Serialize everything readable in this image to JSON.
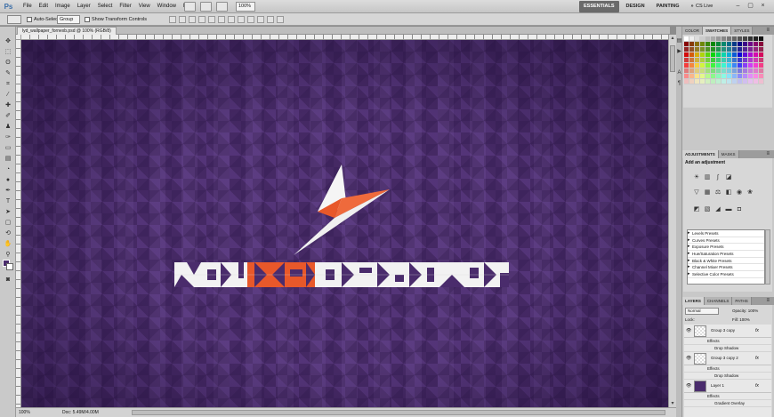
{
  "menubar": {
    "logo": "Ps",
    "items": [
      "File",
      "Edit",
      "Image",
      "Layer",
      "Select",
      "Filter",
      "View",
      "Window",
      "Help"
    ],
    "zoom": "100%",
    "workspaces": [
      "ESSENTIALS",
      "DESIGN",
      "PAINTING",
      "»"
    ],
    "cs_live": "CS Live",
    "window_buttons": [
      "–",
      "▢",
      "×"
    ]
  },
  "optionsbar": {
    "auto_select_label": "Auto-Select:",
    "auto_select_value": "Group",
    "show_transform_label": "Show Transform Controls"
  },
  "document": {
    "tab_title": "lyd_wallpaper_fornexb.psd @ 100% (RGB/8)",
    "status_zoom": "100%",
    "status_doc": "Doc: 5.49M/4.00M"
  },
  "artwork": {
    "logo_text": "YOUTHDESIGNER",
    "colors": {
      "background": "#4a2c6c",
      "accent": "#e8582a",
      "white": "#f2f2f2"
    }
  },
  "panels": {
    "top_tabs": [
      "COLOR",
      "SWATCHES",
      "STYLES"
    ],
    "top_active": 1,
    "adjust_tabs": [
      "ADJUSTMENTS",
      "MASKS"
    ],
    "adjust_active": 0,
    "adjust_title": "Add an adjustment",
    "presets": [
      "Levels Presets",
      "Curves Presets",
      "Exposure Presets",
      "Hue/Saturation Presets",
      "Black & White Presets",
      "Channel Mixer Presets",
      "Selective Color Presets"
    ],
    "layer_tabs": [
      "LAYERS",
      "CHANNELS",
      "PATHS"
    ],
    "layer_active": 0,
    "blend_mode": "Normal",
    "opacity_label": "Opacity:",
    "opacity_value": "100%",
    "fill_label": "Fill:",
    "fill_value": "100%",
    "lock_label": "Lock:",
    "layers": [
      {
        "name": "Group 3 copy",
        "effects_label": "Effects",
        "effect": "Drop Shadow"
      },
      {
        "name": "Group 3 copy 2",
        "effects_label": "Effects",
        "effect": "Drop Shadow"
      },
      {
        "name": "Layer 1",
        "effects_label": "Effects",
        "effect": "Gradient Overlay"
      }
    ]
  }
}
